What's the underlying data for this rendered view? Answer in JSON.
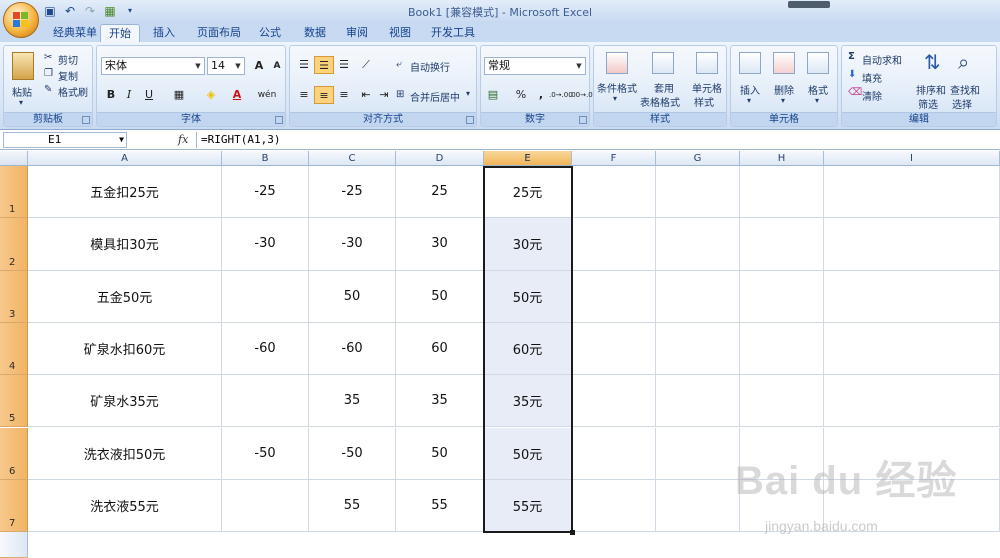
{
  "window": {
    "title": "Book1  [兼容模式] - ",
    "app_name": "Microsoft Excel"
  },
  "tabs": [
    "经典菜单",
    "开始",
    "插入",
    "页面布局",
    "公式",
    "数据",
    "审阅",
    "视图",
    "开发工具"
  ],
  "active_tab": "开始",
  "clipboard": {
    "paste": "粘贴",
    "cut": "剪切",
    "copy": "复制",
    "format_painter": "格式刷",
    "label": "剪贴板"
  },
  "font": {
    "name": "宋体",
    "size": "14",
    "grow": "A",
    "shrink": "A",
    "bold": "B",
    "italic": "I",
    "underline": "U",
    "color_glyph": "A",
    "phonetic": "wén",
    "label": "字体"
  },
  "alignment": {
    "wrap": "自动换行",
    "merge": "合并后居中",
    "label": "对齐方式"
  },
  "number": {
    "format": "常规",
    "percent": "%",
    "comma": ",",
    "inc": ".0→.00",
    "dec": ".00→.0",
    "label": "数字"
  },
  "styles": {
    "conditional": "条件格式",
    "table_a": "套用",
    "table_b": "表格格式",
    "cell_a": "单元格",
    "cell_b": "样式",
    "label": "样式"
  },
  "cells": {
    "insert": "插入",
    "delete": "删除",
    "format": "格式",
    "label": "单元格"
  },
  "editing": {
    "autosum": "自动求和",
    "fill": "填充",
    "clear": "清除",
    "sort_a": "排序和",
    "sort_b": "筛选",
    "find_a": "查找和",
    "find_b": "选择",
    "label": "编辑"
  },
  "formula_bar": {
    "name_box": "E1",
    "fx": "fx",
    "formula": "=RIGHT(A1,3)"
  },
  "grid": {
    "columns": [
      "A",
      "B",
      "C",
      "D",
      "E",
      "F",
      "G",
      "H",
      "I"
    ],
    "selected_column": "E",
    "rows": [
      {
        "num": "1",
        "A": "五金扣25元",
        "B": "-25",
        "C": "-25",
        "D": "25",
        "E": "25元"
      },
      {
        "num": "2",
        "A": "模具扣30元",
        "B": "-30",
        "C": "-30",
        "D": "30",
        "E": "30元"
      },
      {
        "num": "3",
        "A": "五金50元",
        "B": "",
        "C": "50",
        "D": "50",
        "E": "50元"
      },
      {
        "num": "4",
        "A": "矿泉水扣60元",
        "B": "-60",
        "C": "-60",
        "D": "60",
        "E": "60元"
      },
      {
        "num": "5",
        "A": "矿泉水35元",
        "B": "",
        "C": "35",
        "D": "35",
        "E": "35元"
      },
      {
        "num": "6",
        "A": "洗衣液扣50元",
        "B": "-50",
        "C": "-50",
        "D": "50",
        "E": "50元"
      },
      {
        "num": "7",
        "A": "洗衣液55元",
        "B": "",
        "C": "55",
        "D": "55",
        "E": "55元"
      }
    ]
  },
  "watermark": {
    "main": "Bai du 经验",
    "sub": "jingyan.baidu.com"
  }
}
